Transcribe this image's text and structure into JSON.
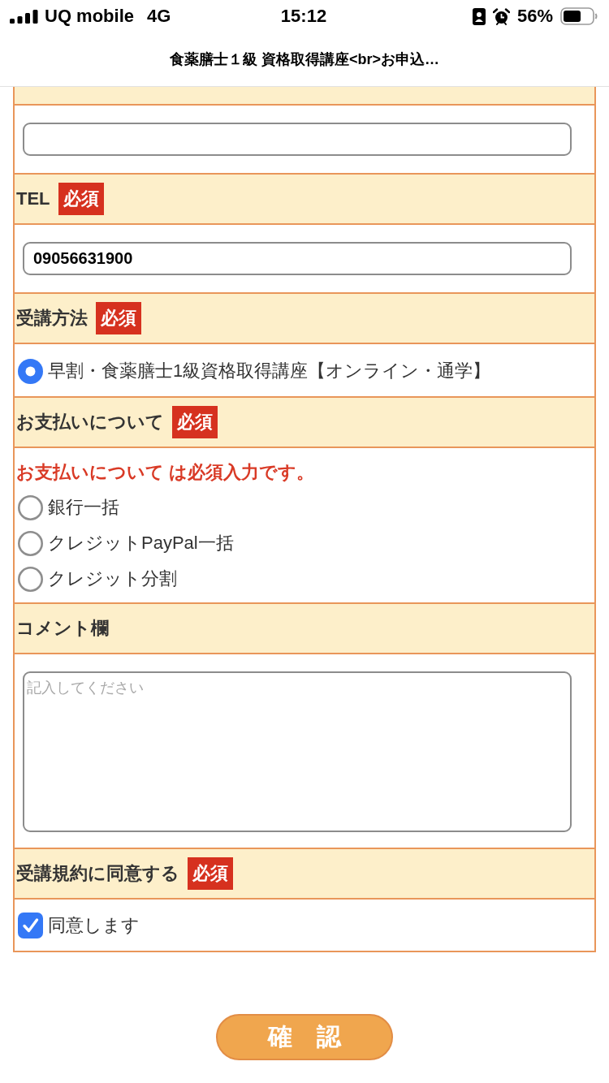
{
  "status_bar": {
    "carrier": "UQ mobile",
    "network": "4G",
    "time": "15:12",
    "battery": "56%"
  },
  "nav_bar": {
    "title": "食薬膳士１級 資格取得講座<br>お申込…"
  },
  "form": {
    "sections": [
      {
        "kind": "text"
      },
      {
        "label": "TEL",
        "badge": "必須",
        "kind": "text",
        "input": {
          "value": "09056631900"
        }
      },
      {
        "label": "受講方法",
        "badge": "必須",
        "kind": "radio",
        "options": [
          {
            "label": "早割・食薬膳士1級資格取得講座【オンライン・通学】",
            "selected": true
          }
        ]
      },
      {
        "label": "お支払いについて",
        "badge": "必須",
        "kind": "radio",
        "error": "お支払いについて は必須入力です。",
        "options": [
          {
            "label": "銀行一括",
            "selected": false
          },
          {
            "label": "クレジットPayPal一括",
            "selected": false
          },
          {
            "label": "クレジット分割",
            "selected": false
          }
        ]
      },
      {
        "label": "コメント欄",
        "kind": "textarea",
        "input": {
          "placeholder": "記入してください"
        }
      },
      {
        "label": "受講規約に同意する",
        "badge": "必須",
        "kind": "checkbox",
        "options": [
          {
            "label": "同意します",
            "checked": true
          }
        ]
      }
    ]
  },
  "submit_button": {
    "label": "確　認"
  }
}
